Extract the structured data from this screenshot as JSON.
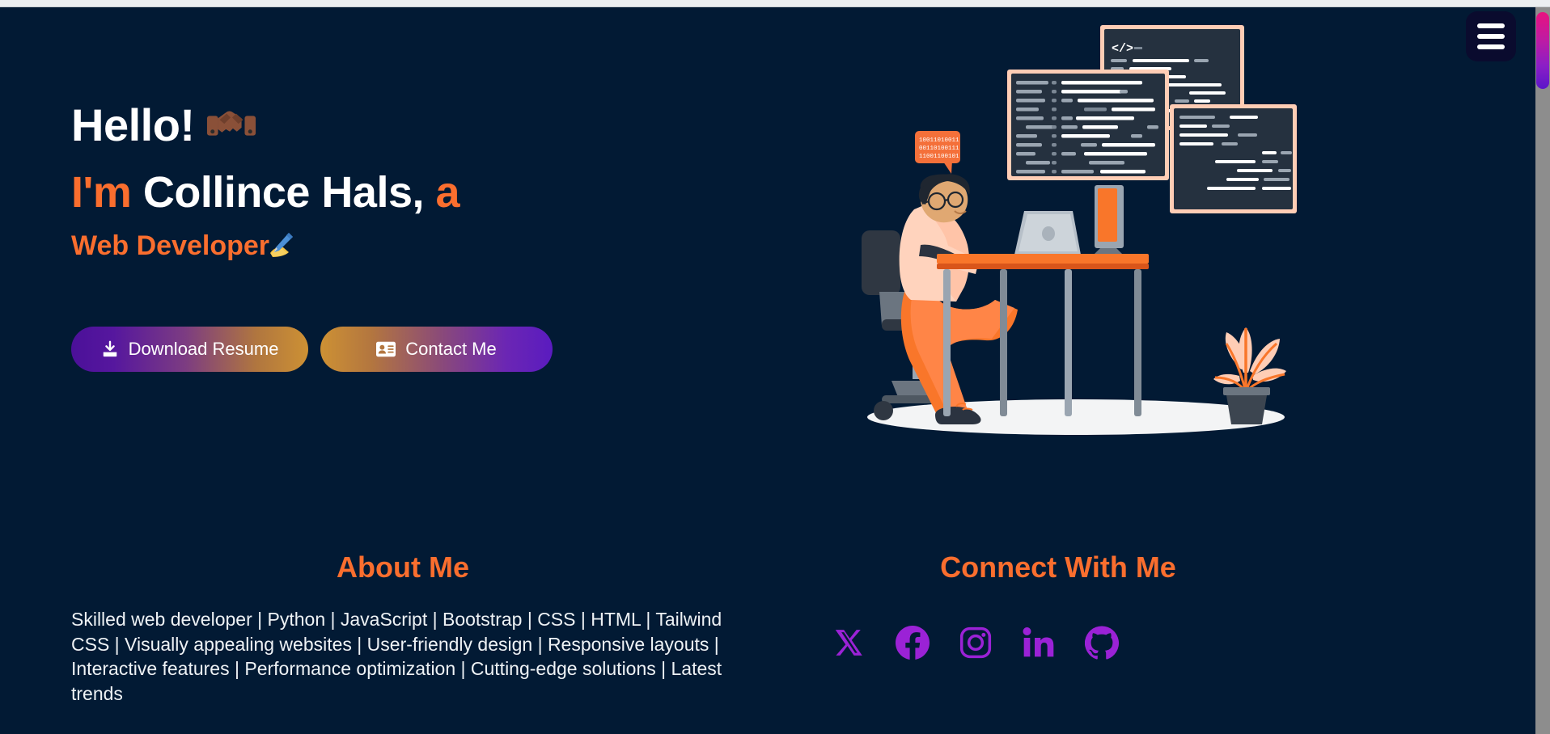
{
  "colors": {
    "background": "#021a34",
    "accent_orange": "#fa6e2e",
    "text_white": "#ffffff",
    "social_purple": "#9b22d6",
    "button_purple": "#4b1099",
    "button_gold": "#cd9134",
    "scrollbar_thumb_start": "#e8127f",
    "scrollbar_thumb_end": "#5b16c9",
    "menu_button_bg": "#0a0b2e"
  },
  "nav": {
    "menu_button_label": "Menu",
    "menu_icon": "hamburger-icon"
  },
  "hero": {
    "greeting": "Hello!",
    "greeting_icon": "handshake-icon",
    "intro_prefix": "I'm",
    "name": "Collince Hals,",
    "intro_suffix": "a",
    "role": "Web Developer",
    "role_icon": "writing-hand-icon",
    "buttons": [
      {
        "label": "Download Resume",
        "icon": "download-icon"
      },
      {
        "label": "Contact Me",
        "icon": "contact-card-icon"
      }
    ],
    "illustration": {
      "name": "developer-at-desk-illustration",
      "speech_bubble_lines": [
        "10011010011",
        "00110100111",
        "11001100101"
      ],
      "code_window_label": "</>"
    }
  },
  "about": {
    "title": "About Me",
    "body": "Skilled web developer | Python | JavaScript | Bootstrap | CSS | HTML | Tailwind CSS | Visually appealing websites | User-friendly design | Responsive layouts | Interactive features | Performance optimization | Cutting-edge solutions | Latest trends"
  },
  "connect": {
    "title": "Connect With Me",
    "socials": [
      {
        "name": "x-twitter",
        "icon": "x-twitter-icon"
      },
      {
        "name": "facebook",
        "icon": "facebook-icon"
      },
      {
        "name": "instagram",
        "icon": "instagram-icon"
      },
      {
        "name": "linkedin",
        "icon": "linkedin-icon"
      },
      {
        "name": "github",
        "icon": "github-icon"
      }
    ]
  },
  "scrollbar": {
    "position": "top",
    "orientation": "vertical"
  }
}
